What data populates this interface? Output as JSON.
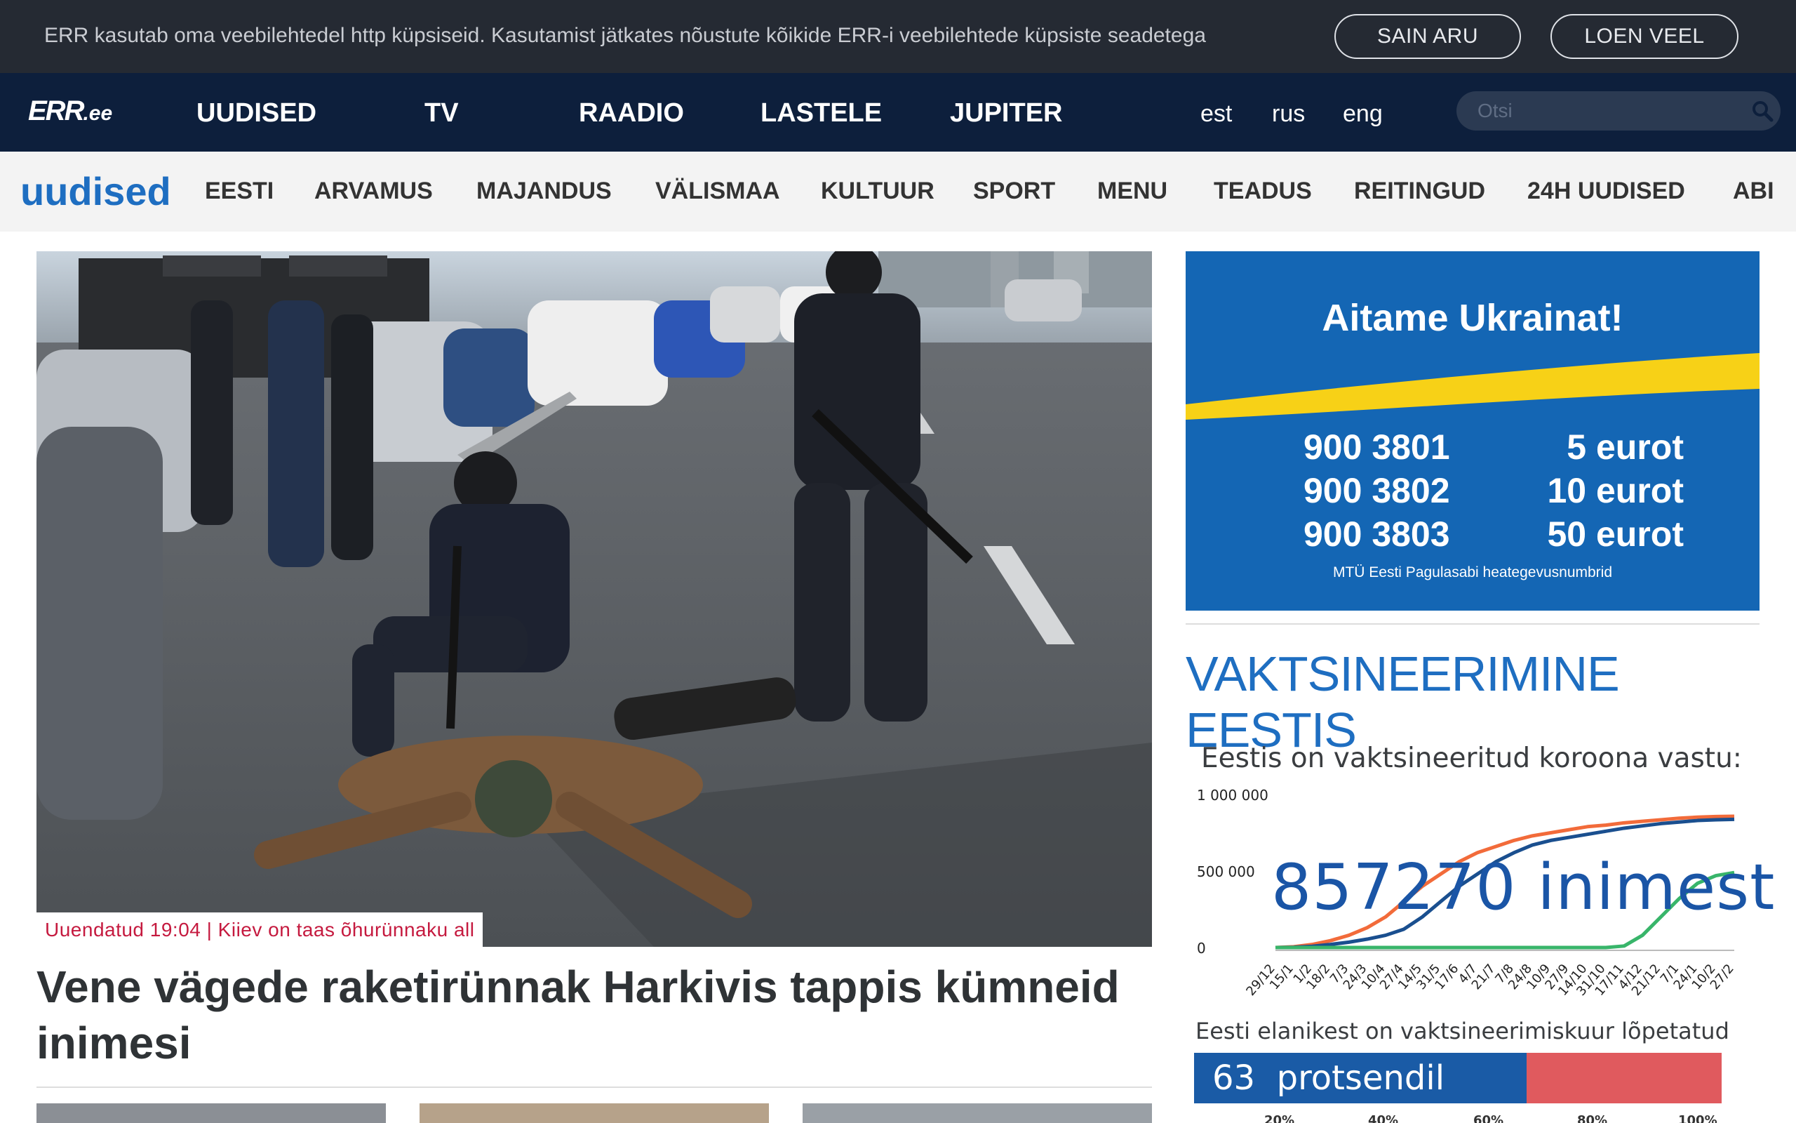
{
  "cookie": {
    "text": "ERR kasutab oma veebilehtedel http küpsiseid. Kasutamist jätkates nõustute kõikide ERR-i veebilehtede küpsiste seadetega",
    "accept_label": "SAIN ARU",
    "more_label": "LOEN VEEL"
  },
  "header": {
    "logo": "ERR",
    "logo_suffix": ".ee",
    "nav": [
      "UUDISED",
      "TV",
      "RAADIO",
      "LASTELE",
      "JUPITER"
    ],
    "languages": [
      "est",
      "rus",
      "eng"
    ],
    "search_placeholder": "Otsi"
  },
  "section_nav": {
    "logo": "uudised",
    "items": [
      "EESTI",
      "ARVAMUS",
      "MAJANDUS",
      "VÄLISMAA",
      "KULTUUR",
      "SPORT",
      "MENU",
      "TEADUS",
      "REITINGUD",
      "24H UUDISED",
      "ABI"
    ]
  },
  "hero": {
    "tag": "Uuendatud 19:04 | Kiiev on taas õhurünnaku all",
    "headline": "Vene vägede raketirünnak Harkivis tappis kümneid inimesi"
  },
  "ukraine_banner": {
    "title": "Aitame Ukrainat!",
    "rows": [
      {
        "number": "900 3801",
        "amount": "5 eurot"
      },
      {
        "number": "900 3802",
        "amount": "10 eurot"
      },
      {
        "number": "900 3803",
        "amount": "50 eurot"
      }
    ],
    "caption": "MTÜ Eesti Pagulasabi heategevusnumbrid",
    "colors": {
      "blue": "#1466b4",
      "yellow": "#f7d117"
    }
  },
  "vaccination": {
    "title": "VAKTSINEERIMINE EESTIS",
    "subtitle": "Eestis on vaktsineeritud koroona vastu:",
    "vaccinated_count": "857270",
    "vaccinated_unit": "inimest",
    "completed_label": "Eesti elanikest on vaktsineerimiskuur lõpetatud",
    "completed_percent": "63",
    "completed_unit": "protsendil",
    "completed_fraction": 0.63,
    "percent_ticks": [
      "20%",
      "40%",
      "60%",
      "80%",
      "100%"
    ]
  },
  "chart_data": {
    "type": "line",
    "title": "",
    "ylim": [
      0,
      1000000
    ],
    "y_ticks": [
      "1 000 000",
      "500 000",
      "0"
    ],
    "x": [
      "29/12",
      "15/1",
      "1/2",
      "18/2",
      "7/3",
      "24/3",
      "10/4",
      "27/4",
      "14/5",
      "31/5",
      "17/6",
      "4/7",
      "21/7",
      "7/8",
      "24/8",
      "10/9",
      "27/9",
      "14/10",
      "31/10",
      "17/11",
      "4/12",
      "21/12",
      "7/1",
      "24/1",
      "10/2",
      "27/2"
    ],
    "series": [
      {
        "color": "#f26b3a",
        "values": [
          0,
          5000,
          20000,
          45000,
          80000,
          130000,
          200000,
          300000,
          400000,
          480000,
          560000,
          620000,
          660000,
          700000,
          730000,
          750000,
          770000,
          790000,
          800000,
          815000,
          825000,
          835000,
          845000,
          852000,
          856000,
          858000
        ]
      },
      {
        "color": "#1a4f8f",
        "values": [
          0,
          2000,
          8000,
          20000,
          35000,
          55000,
          80000,
          120000,
          200000,
          300000,
          400000,
          480000,
          560000,
          620000,
          670000,
          700000,
          720000,
          740000,
          760000,
          780000,
          795000,
          810000,
          820000,
          830000,
          835000,
          838000
        ]
      },
      {
        "color": "#38b56a",
        "values": [
          0,
          0,
          0,
          0,
          0,
          0,
          0,
          0,
          0,
          0,
          0,
          0,
          0,
          0,
          0,
          0,
          0,
          0,
          0,
          10000,
          80000,
          200000,
          320000,
          420000,
          470000,
          490000
        ]
      }
    ],
    "grid": false
  }
}
